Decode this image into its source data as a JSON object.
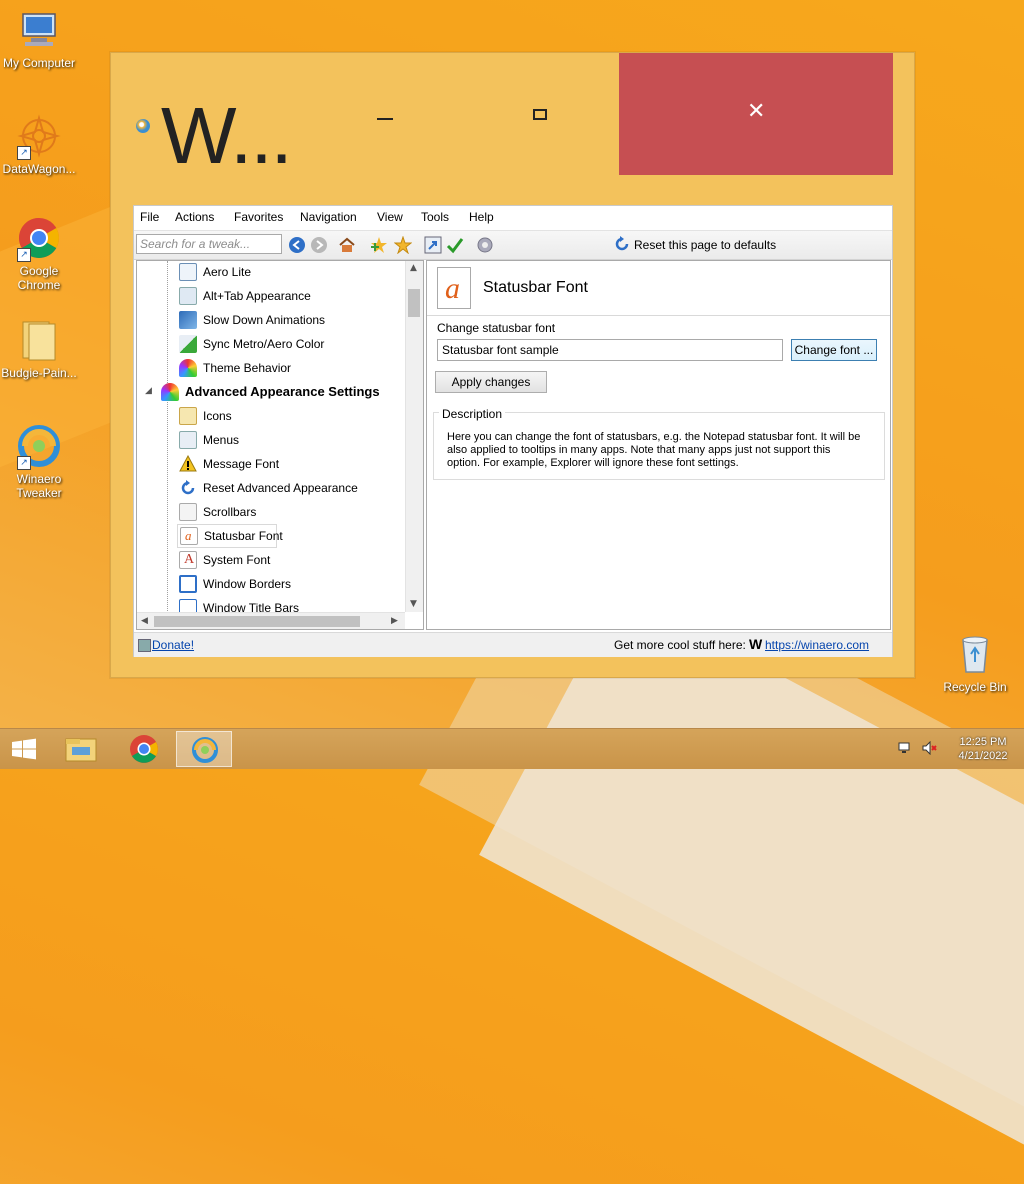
{
  "desktop": {
    "icons": [
      {
        "label": "My Computer",
        "icon": "computer-icon"
      },
      {
        "label": "DataWagon...",
        "icon": "datawagon-icon"
      },
      {
        "label": "Google Chrome",
        "icon": "chrome-icon"
      },
      {
        "label": "Budgie-Pain...",
        "icon": "folder-icon"
      },
      {
        "label": "Winaero Tweaker",
        "icon": "winaero-icon"
      },
      {
        "label": "Recycle Bin",
        "icon": "recycle-bin-icon"
      }
    ]
  },
  "window": {
    "title": "W...",
    "close_symbol": "✕",
    "colors": {
      "frame": "#f3c25c",
      "close": "#c64f52"
    }
  },
  "menu": [
    "File",
    "Actions",
    "Favorites",
    "Navigation",
    "View",
    "Tools",
    "Help"
  ],
  "toolbar": {
    "search_placeholder": "Search for a tweak...",
    "reset_label": "Reset this page to defaults"
  },
  "tree": {
    "items": [
      {
        "label": "Aero Lite",
        "level": 2
      },
      {
        "label": "Alt+Tab Appearance",
        "level": 2
      },
      {
        "label": "Slow Down Animations",
        "level": 2
      },
      {
        "label": "Sync Metro/Aero Color",
        "level": 2
      },
      {
        "label": "Theme Behavior",
        "level": 2
      },
      {
        "label": "Advanced Appearance Settings",
        "level": 1,
        "expanded": true
      },
      {
        "label": "Icons",
        "level": 2
      },
      {
        "label": "Menus",
        "level": 2
      },
      {
        "label": "Message Font",
        "level": 2
      },
      {
        "label": "Reset Advanced Appearance",
        "level": 2
      },
      {
        "label": "Scrollbars",
        "level": 2
      },
      {
        "label": "Statusbar Font",
        "level": 2,
        "selected": true
      },
      {
        "label": "System Font",
        "level": 2
      },
      {
        "label": "Window Borders",
        "level": 2
      },
      {
        "label": "Window Title Bars",
        "level": 2
      }
    ]
  },
  "panel": {
    "title": "Statusbar Font",
    "icon_glyph": "a",
    "change_label": "Change statusbar font",
    "sample_value": "Statusbar font sample",
    "change_button": "Change font ...",
    "apply_button": "Apply changes",
    "description_title": "Description",
    "description_text": "Here you can change the font of statusbars, e.g. the Notepad statusbar font. It will be also applied to tooltips in many apps. Note that many apps just not support this option. For example, Explorer will ignore these font settings."
  },
  "statusbar": {
    "donate": "Donate!",
    "more": "Get more cool stuff here:",
    "logo": "W",
    "link": "https://winaero.com"
  },
  "taskbar": {
    "time": "12:25 PM",
    "date": "4/21/2022"
  }
}
